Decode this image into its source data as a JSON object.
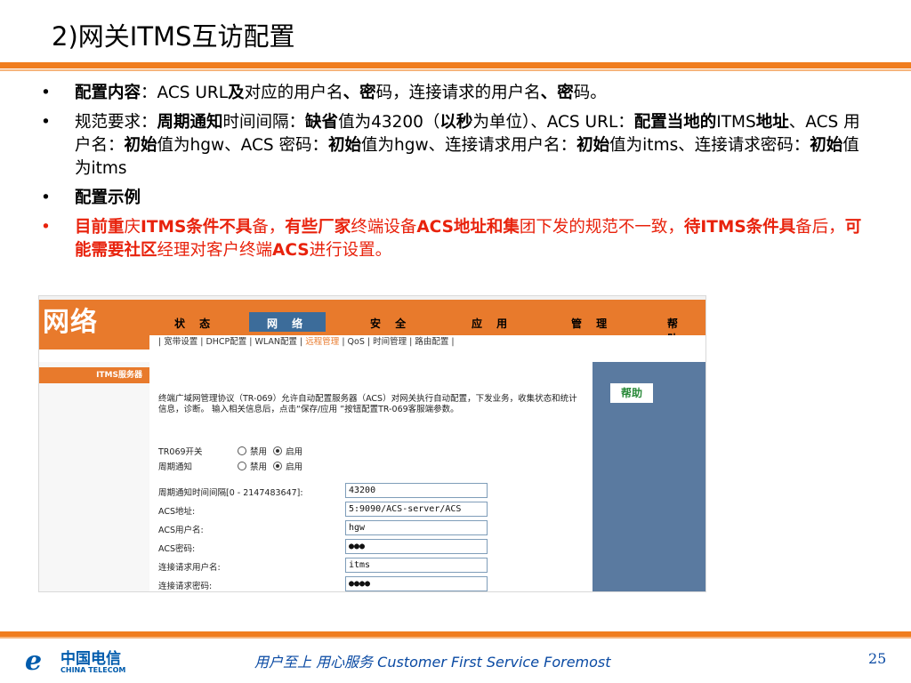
{
  "title": "2)网关ITMS互访配置",
  "bullets": {
    "b1": {
      "dot": "•",
      "t1": "配置内容",
      "t2": "：ACS URL",
      "t3": "及",
      "t4": "对应的用户名",
      "t5": "、",
      "t6": "密",
      "t7": "码，连接请求的用户名",
      "t8": "、",
      "t9": "密",
      "t10": "码。"
    },
    "b2": {
      "dot": "•",
      "t1": "规范要求：",
      "t2": "周期通知",
      "t3": "时间间隔：",
      "t4": "缺省",
      "t5": "值为43200（",
      "t6": "以秒",
      "t7": "为单位）、ACS URL：",
      "t8": "配置当地的",
      "t9": "ITMS",
      "t10": "地址",
      "t11": "、ACS 用",
      "t12": "户名：",
      "t13": "初始",
      "t14": "值为hgw、ACS 密",
      "t15": "码：",
      "t16": "初始",
      "t17": "值为hgw、连接请求用户名：",
      "t18": "初始",
      "t19": "值为itms、连接请求密码：",
      "t20": "初始",
      "t21": "值为itms"
    },
    "b3": {
      "dot": "•",
      "t1": "配置示例"
    },
    "b4": {
      "dot": "•",
      "t1": "目前重",
      "t2": "庆",
      "t3": "ITMS条件不具",
      "t4": "备，",
      "t5": "有些厂家",
      "t6": "终端设备",
      "t7": "ACS地址和集",
      "t8": "团下发的规范不一致，",
      "t9": "待",
      "t10": "ITMS条件具",
      "t11": "备后，",
      "t12": "可能需要社区",
      "t13": "经理对客户终端",
      "t14": "ACS",
      "t15": "进行设置。"
    }
  },
  "shot": {
    "logo": "网络",
    "nav": [
      "状 态",
      "网 络",
      "安 全",
      "应 用",
      "管 理",
      "帮 助"
    ],
    "subnav": "| 宽带设置 | DHCP配置 | WLAN配置 | ",
    "subnav_active": "远程管理",
    "subnav_rest": " | QoS | 时间管理 | 路由配置 |",
    "left_item": "ITMS服务器",
    "help": "帮助",
    "desc": "终端广域网管理协议（TR-069）允许自动配置服务器（ACS）对网关执行自动配置，下发业务，收集状态和统计信息，诊断。 输入相关信息后，点击“保存/应用 ”按钮配置TR-069客服端参数。",
    "tr069_label": "TR069开关",
    "periodic_label": "周期通知",
    "disable": "禁用",
    "enable": "启用",
    "interval_label": "周期通知时间间隔[0 - 2147483647]:",
    "interval_value": "43200",
    "acs_addr_label": "ACS地址:",
    "acs_addr_value": "5:9090/ACS-server/ACS",
    "acs_user_label": "ACS用户名:",
    "acs_user_value": "hgw",
    "acs_pass_label": "ACS密码:",
    "acs_pass_value": "●●●",
    "conn_user_label": "连接请求用户名:",
    "conn_user_value": "itms",
    "conn_pass_label": "连接请求密码:",
    "conn_pass_value": "●●●●"
  },
  "footer": {
    "logo_cn": "中国电信",
    "logo_en": "CHINA TELECOM",
    "slogan": "用户至上 用心服务 Customer First Service Foremost",
    "page": "25"
  },
  "colors": {
    "accent": "#f07d1e",
    "red": "#e8220c",
    "blue": "#0a4aa3",
    "panel": "#5a7aa0"
  }
}
